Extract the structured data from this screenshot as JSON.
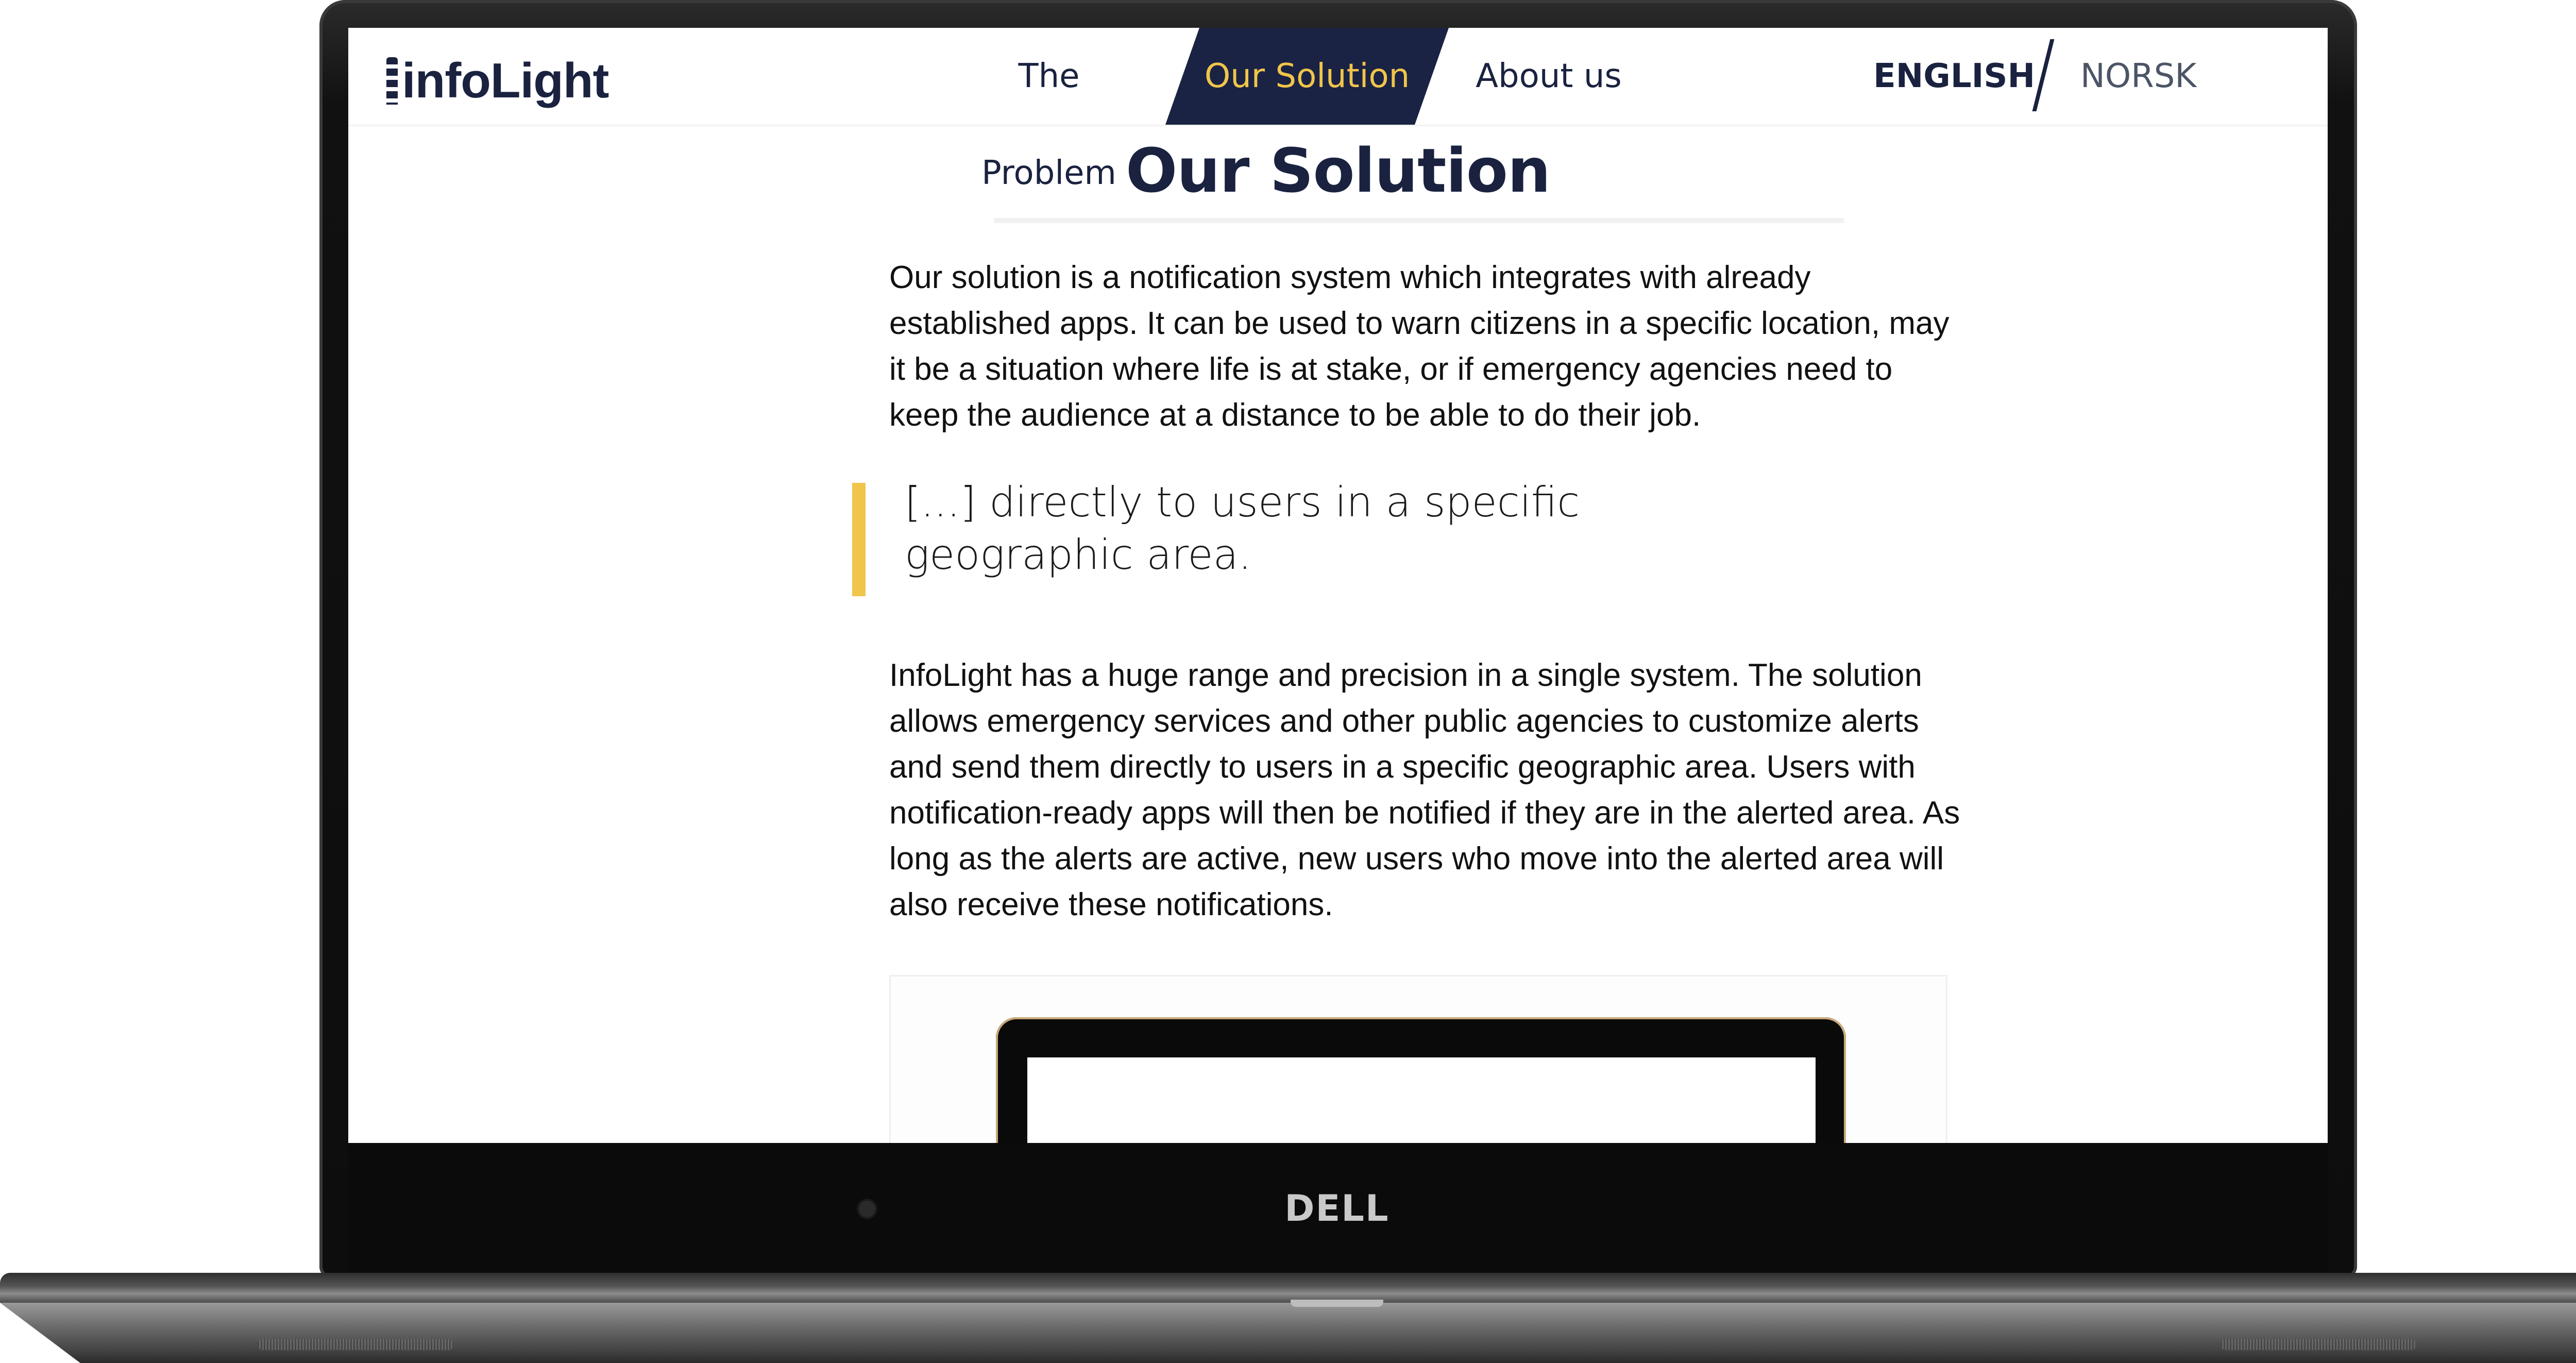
{
  "device": {
    "brand": "DELL"
  },
  "header": {
    "logo_text": "infoLight",
    "nav": [
      {
        "label": "The Problem",
        "active": false
      },
      {
        "label": "Our Solution",
        "active": true
      },
      {
        "label": "About us",
        "active": false
      }
    ],
    "languages": [
      {
        "label": "ENGLISH",
        "active": true
      },
      {
        "label": "NORSK",
        "active": false
      }
    ]
  },
  "main": {
    "title": "Our Solution",
    "intro": "Our solution is a notification system which integrates with already established apps. It can be used to warn citizens in a specific location, may it be a situation where life is at stake, or if emergency agencies need to keep the audience at a distance to be able to do their job.",
    "quote": "[...] directly to users in a specific geographic area.",
    "body": "InfoLight has a huge range and precision in a single system. The solution allows emergency services and other public agencies to customize alerts and send them directly to users in a specific geographic area. Users with notification-ready apps will then be notified if they are in the alerted area. As long as the alerts are active, new users who move into the alerted area will also receive these notifications."
  },
  "colors": {
    "navy": "#1a2240",
    "accent": "#f0c54a",
    "nav_active_bg": "#1b2344"
  },
  "icons": {
    "logo_mark": "lighthouse-icon"
  }
}
